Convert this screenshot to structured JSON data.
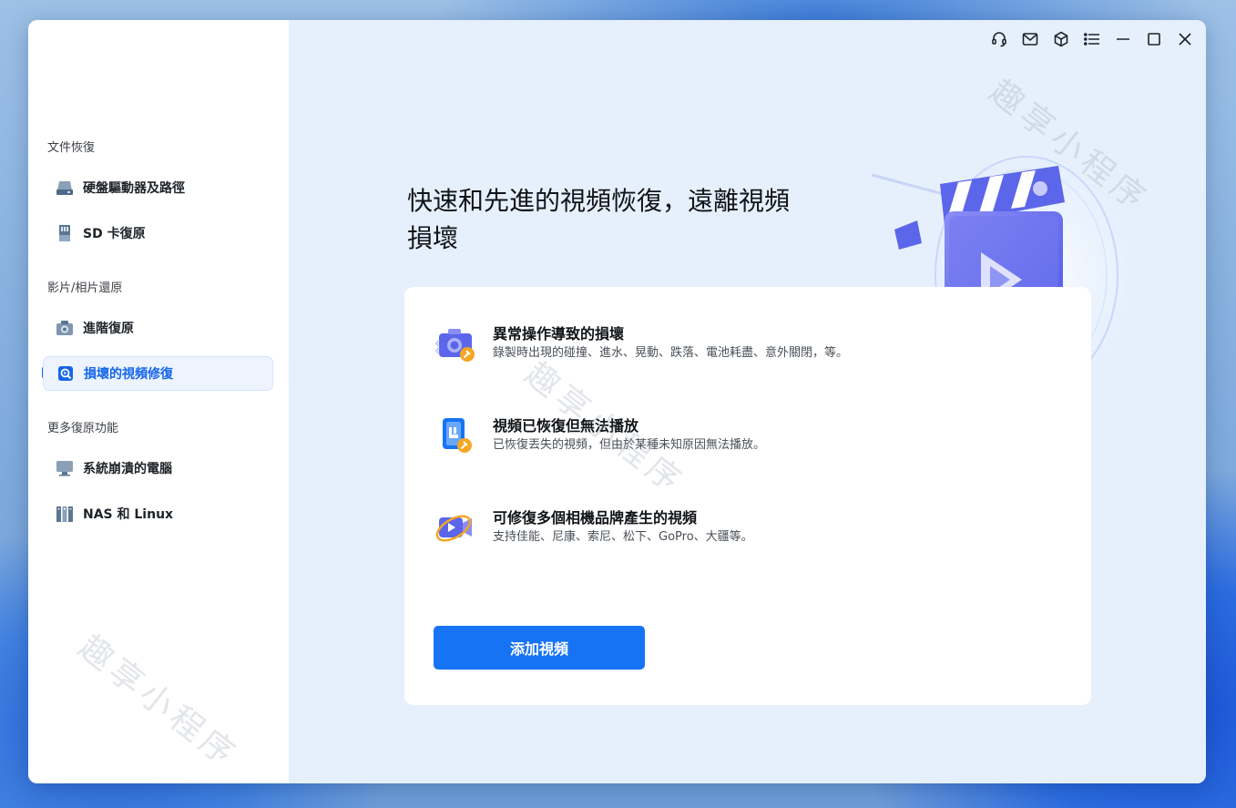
{
  "sidebar": {
    "sections": [
      {
        "title": "文件恢復",
        "items": [
          {
            "label": "硬盤驅動器及路徑",
            "icon": "hard-drive-icon"
          },
          {
            "label": "SD 卡復原",
            "icon": "sd-card-icon"
          }
        ]
      },
      {
        "title": "影片/相片還原",
        "items": [
          {
            "label": "進階復原",
            "icon": "camera-icon"
          },
          {
            "label": "損壞的視頻修復",
            "icon": "video-repair-icon",
            "active": true
          }
        ]
      },
      {
        "title": "更多復原功能",
        "items": [
          {
            "label": "系統崩潰的電腦",
            "icon": "computer-icon"
          },
          {
            "label": "NAS 和 Linux",
            "icon": "nas-icon"
          }
        ]
      }
    ]
  },
  "toolbar": {
    "icons": [
      "headset-icon",
      "mail-icon",
      "cube-icon",
      "menu-icon",
      "minimize-icon",
      "maximize-icon",
      "close-icon"
    ]
  },
  "main": {
    "headline_line1": "快速和先進的視頻恢復，遠離視頻",
    "headline_line2": "損壞",
    "features": [
      {
        "title": "異常操作導致的損壞",
        "desc": "錄製時出現的碰撞、進水、晃動、跌落、電池耗盡、意外關閉，等。"
      },
      {
        "title": "視頻已恢復但無法播放",
        "desc": "已恢復丟失的視頻，但由於某種未知原因無法播放。"
      },
      {
        "title": "可修復多個相機品牌產生的視頻",
        "desc": "支持佳能、尼康、索尼、松下、GoPro、大疆等。"
      }
    ],
    "add_button": "添加視頻"
  },
  "watermark": "趣享小程序",
  "colors": {
    "accent": "#1673f4",
    "sidebar_bg": "#ffffff",
    "main_bg": "#e6f0fd"
  }
}
